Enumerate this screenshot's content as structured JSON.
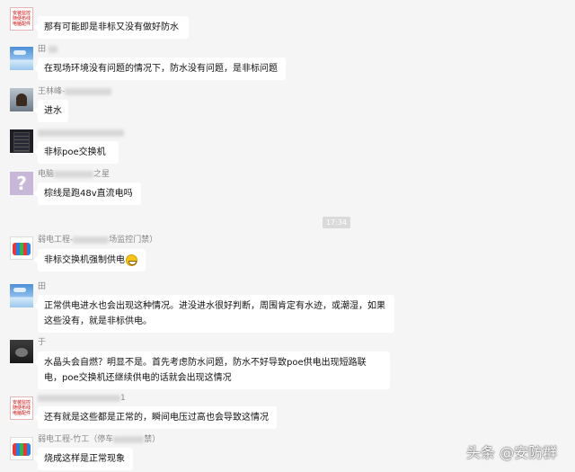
{
  "messages": [
    {
      "sender": "",
      "text": "那有可能即是非标又没有做好防水",
      "avatar": "red-logo-avatar"
    },
    {
      "sender": "田",
      "text": "在现场环境没有问题的情况下，防水没有问题，是非标问题",
      "avatar": "sky-avatar"
    },
    {
      "sender": "王林峰-",
      "text": "进水",
      "avatar": "man-photo-avatar"
    },
    {
      "sender": "",
      "text": "非标poe交换机",
      "avatar": "dark-photo-avatar"
    },
    {
      "sender": "电脑",
      "sender_suffix": "之星",
      "text": "棕线是跑48v直流电吗",
      "avatar": "question-mark-avatar"
    },
    {
      "sender": "弱电工程-",
      "sender_suffix": "场监控门禁）",
      "text": "非标交换机强制供电",
      "avatar": "toys-avatar",
      "emoji": "grin-emoji"
    },
    {
      "sender": "田",
      "text": "正常供电进水也会出现这种情况。进没进水很好判断，周围肯定有水迹，或潮湿，如果这些没有，就是非标供电。",
      "avatar": "sky-avatar"
    },
    {
      "sender": "于",
      "text": "水晶头会自燃？明显不是。首先考虑防水问题，防水不好导致poe供电出现短路联电，poe交换机还继续供电的话就会出现这情况",
      "avatar": "dark-photo-avatar"
    },
    {
      "sender": "1",
      "text": "还有就是这些都是正常的，瞬间电压过高也会导致这情况",
      "avatar": "red-logo-avatar"
    },
    {
      "sender": "弱电工程-竹工（停车",
      "sender_suffix": "禁）",
      "text": "烧成这样是正常现象",
      "avatar": "toys-avatar"
    }
  ],
  "red_logo_text": "安装监控 随便布线 电脑配件",
  "time_divider": "17:34",
  "watermark": "头条 @安防群"
}
